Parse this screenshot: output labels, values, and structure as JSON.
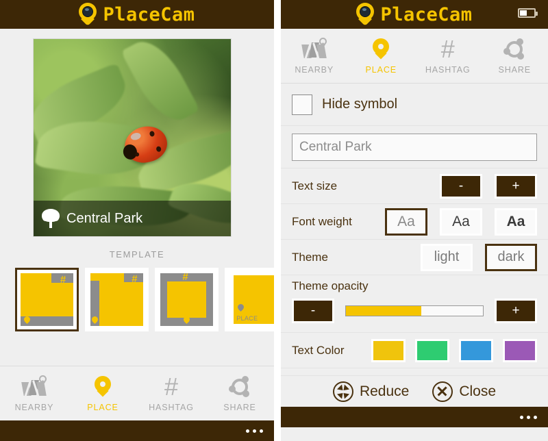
{
  "app": {
    "title": "PlaceCam",
    "logo_icon": "map-pin-camera-icon",
    "battery_icon": "battery-half-icon"
  },
  "left": {
    "photo": {
      "alt": "ladybug-on-leaf-photo",
      "caption": "Central Park",
      "caption_icon": "tree-icon"
    },
    "template": {
      "label": "TEMPLATE",
      "items": [
        {
          "name": "template-1",
          "selected": true,
          "hashtag": "#",
          "place_label": ""
        },
        {
          "name": "template-2",
          "selected": false,
          "hashtag": "#",
          "place_label": ""
        },
        {
          "name": "template-3",
          "selected": false,
          "hashtag": "#",
          "place_label": ""
        },
        {
          "name": "template-4",
          "selected": false,
          "hashtag": "",
          "place_label": "PLACE"
        }
      ]
    },
    "tabs": [
      {
        "label": "NEARBY",
        "icon": "map-icon",
        "active": false
      },
      {
        "label": "PLACE",
        "icon": "pin-icon",
        "active": true
      },
      {
        "label": "HASHTAG",
        "icon": "hashtag-icon",
        "active": false
      },
      {
        "label": "SHARE",
        "icon": "share-icon",
        "active": false
      }
    ],
    "appbar_more": "..."
  },
  "right": {
    "tabs": [
      {
        "label": "NEARBY",
        "icon": "map-icon",
        "active": false
      },
      {
        "label": "PLACE",
        "icon": "pin-icon",
        "active": true
      },
      {
        "label": "HASHTAG",
        "icon": "hashtag-icon",
        "active": false
      },
      {
        "label": "SHARE",
        "icon": "share-icon",
        "active": false
      }
    ],
    "hide_symbol": {
      "label": "Hide symbol",
      "checked": false
    },
    "place_input": {
      "value": "Central Park",
      "placeholder": "Central Park"
    },
    "text_size": {
      "label": "Text size",
      "minus": "-",
      "plus": "+"
    },
    "font_weight": {
      "label": "Font weight",
      "options": [
        {
          "label": "Aa",
          "weight": "light",
          "selected": true
        },
        {
          "label": "Aa",
          "weight": "regular",
          "selected": false
        },
        {
          "label": "Aa",
          "weight": "bold",
          "selected": false
        }
      ]
    },
    "theme": {
      "label": "Theme",
      "options": [
        {
          "label": "light",
          "selected": false
        },
        {
          "label": "dark",
          "selected": true
        }
      ]
    },
    "theme_opacity": {
      "label": "Theme opacity",
      "minus": "-",
      "plus": "+",
      "value_percent": 55,
      "fill_color": "#f5c400"
    },
    "text_color": {
      "label": "Text Color",
      "swatches": [
        {
          "name": "yellow",
          "hex": "#f0c40c"
        },
        {
          "name": "green",
          "hex": "#2ecc71"
        },
        {
          "name": "blue",
          "hex": "#3498db"
        },
        {
          "name": "purple",
          "hex": "#9b59b6"
        }
      ]
    },
    "appbar": {
      "reduce": {
        "label": "Reduce",
        "icon": "reduce-icon"
      },
      "close": {
        "label": "Close",
        "icon": "close-icon"
      }
    },
    "appbar_more": "..."
  },
  "colors": {
    "brand_brown": "#3d2706",
    "brand_yellow": "#f5c400",
    "panel_bg": "#efefef"
  }
}
